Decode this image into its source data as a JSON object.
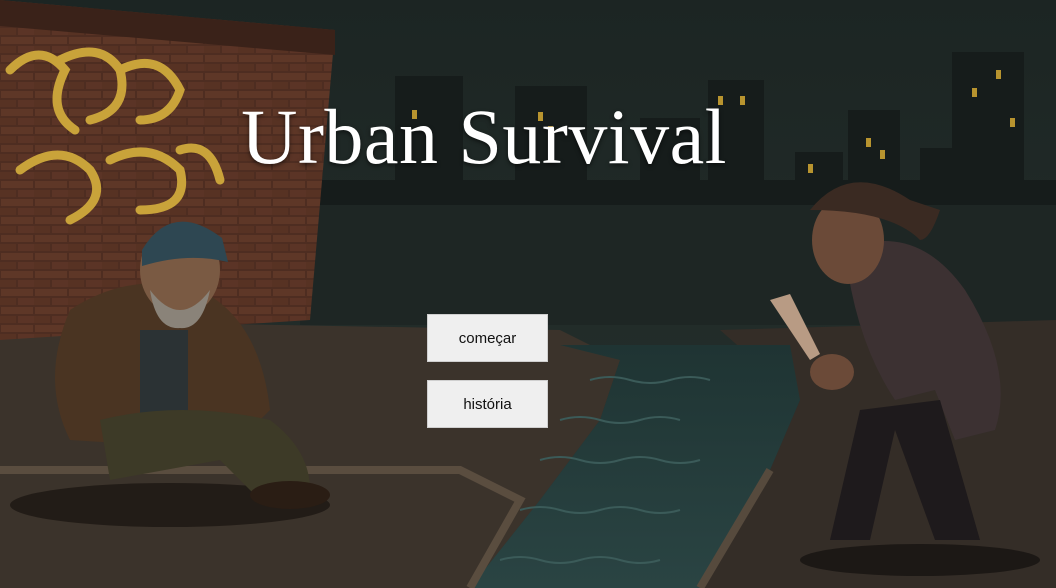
{
  "game": {
    "title": "Urban Survival"
  },
  "menu": {
    "start_label": "começar",
    "story_label": "história"
  },
  "palette": {
    "sky": "#1e2a28",
    "brick": "#5a3324",
    "graffiti": "#c9a33a",
    "water": "#1f3a3a",
    "ground": "#3a322a",
    "button_bg": "#efefef"
  }
}
